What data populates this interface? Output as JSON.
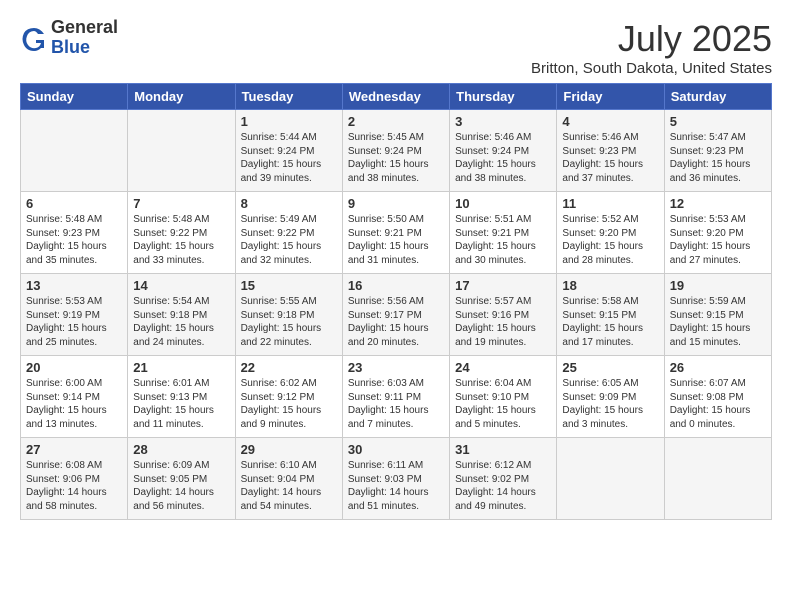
{
  "logo": {
    "general": "General",
    "blue": "Blue"
  },
  "title": "July 2025",
  "subtitle": "Britton, South Dakota, United States",
  "days_header": [
    "Sunday",
    "Monday",
    "Tuesday",
    "Wednesday",
    "Thursday",
    "Friday",
    "Saturday"
  ],
  "weeks": [
    [
      {
        "day": "",
        "info": ""
      },
      {
        "day": "",
        "info": ""
      },
      {
        "day": "1",
        "info": "Sunrise: 5:44 AM\nSunset: 9:24 PM\nDaylight: 15 hours\nand 39 minutes."
      },
      {
        "day": "2",
        "info": "Sunrise: 5:45 AM\nSunset: 9:24 PM\nDaylight: 15 hours\nand 38 minutes."
      },
      {
        "day": "3",
        "info": "Sunrise: 5:46 AM\nSunset: 9:24 PM\nDaylight: 15 hours\nand 38 minutes."
      },
      {
        "day": "4",
        "info": "Sunrise: 5:46 AM\nSunset: 9:23 PM\nDaylight: 15 hours\nand 37 minutes."
      },
      {
        "day": "5",
        "info": "Sunrise: 5:47 AM\nSunset: 9:23 PM\nDaylight: 15 hours\nand 36 minutes."
      }
    ],
    [
      {
        "day": "6",
        "info": "Sunrise: 5:48 AM\nSunset: 9:23 PM\nDaylight: 15 hours\nand 35 minutes."
      },
      {
        "day": "7",
        "info": "Sunrise: 5:48 AM\nSunset: 9:22 PM\nDaylight: 15 hours\nand 33 minutes."
      },
      {
        "day": "8",
        "info": "Sunrise: 5:49 AM\nSunset: 9:22 PM\nDaylight: 15 hours\nand 32 minutes."
      },
      {
        "day": "9",
        "info": "Sunrise: 5:50 AM\nSunset: 9:21 PM\nDaylight: 15 hours\nand 31 minutes."
      },
      {
        "day": "10",
        "info": "Sunrise: 5:51 AM\nSunset: 9:21 PM\nDaylight: 15 hours\nand 30 minutes."
      },
      {
        "day": "11",
        "info": "Sunrise: 5:52 AM\nSunset: 9:20 PM\nDaylight: 15 hours\nand 28 minutes."
      },
      {
        "day": "12",
        "info": "Sunrise: 5:53 AM\nSunset: 9:20 PM\nDaylight: 15 hours\nand 27 minutes."
      }
    ],
    [
      {
        "day": "13",
        "info": "Sunrise: 5:53 AM\nSunset: 9:19 PM\nDaylight: 15 hours\nand 25 minutes."
      },
      {
        "day": "14",
        "info": "Sunrise: 5:54 AM\nSunset: 9:18 PM\nDaylight: 15 hours\nand 24 minutes."
      },
      {
        "day": "15",
        "info": "Sunrise: 5:55 AM\nSunset: 9:18 PM\nDaylight: 15 hours\nand 22 minutes."
      },
      {
        "day": "16",
        "info": "Sunrise: 5:56 AM\nSunset: 9:17 PM\nDaylight: 15 hours\nand 20 minutes."
      },
      {
        "day": "17",
        "info": "Sunrise: 5:57 AM\nSunset: 9:16 PM\nDaylight: 15 hours\nand 19 minutes."
      },
      {
        "day": "18",
        "info": "Sunrise: 5:58 AM\nSunset: 9:15 PM\nDaylight: 15 hours\nand 17 minutes."
      },
      {
        "day": "19",
        "info": "Sunrise: 5:59 AM\nSunset: 9:15 PM\nDaylight: 15 hours\nand 15 minutes."
      }
    ],
    [
      {
        "day": "20",
        "info": "Sunrise: 6:00 AM\nSunset: 9:14 PM\nDaylight: 15 hours\nand 13 minutes."
      },
      {
        "day": "21",
        "info": "Sunrise: 6:01 AM\nSunset: 9:13 PM\nDaylight: 15 hours\nand 11 minutes."
      },
      {
        "day": "22",
        "info": "Sunrise: 6:02 AM\nSunset: 9:12 PM\nDaylight: 15 hours\nand 9 minutes."
      },
      {
        "day": "23",
        "info": "Sunrise: 6:03 AM\nSunset: 9:11 PM\nDaylight: 15 hours\nand 7 minutes."
      },
      {
        "day": "24",
        "info": "Sunrise: 6:04 AM\nSunset: 9:10 PM\nDaylight: 15 hours\nand 5 minutes."
      },
      {
        "day": "25",
        "info": "Sunrise: 6:05 AM\nSunset: 9:09 PM\nDaylight: 15 hours\nand 3 minutes."
      },
      {
        "day": "26",
        "info": "Sunrise: 6:07 AM\nSunset: 9:08 PM\nDaylight: 15 hours\nand 0 minutes."
      }
    ],
    [
      {
        "day": "27",
        "info": "Sunrise: 6:08 AM\nSunset: 9:06 PM\nDaylight: 14 hours\nand 58 minutes."
      },
      {
        "day": "28",
        "info": "Sunrise: 6:09 AM\nSunset: 9:05 PM\nDaylight: 14 hours\nand 56 minutes."
      },
      {
        "day": "29",
        "info": "Sunrise: 6:10 AM\nSunset: 9:04 PM\nDaylight: 14 hours\nand 54 minutes."
      },
      {
        "day": "30",
        "info": "Sunrise: 6:11 AM\nSunset: 9:03 PM\nDaylight: 14 hours\nand 51 minutes."
      },
      {
        "day": "31",
        "info": "Sunrise: 6:12 AM\nSunset: 9:02 PM\nDaylight: 14 hours\nand 49 minutes."
      },
      {
        "day": "",
        "info": ""
      },
      {
        "day": "",
        "info": ""
      }
    ]
  ]
}
